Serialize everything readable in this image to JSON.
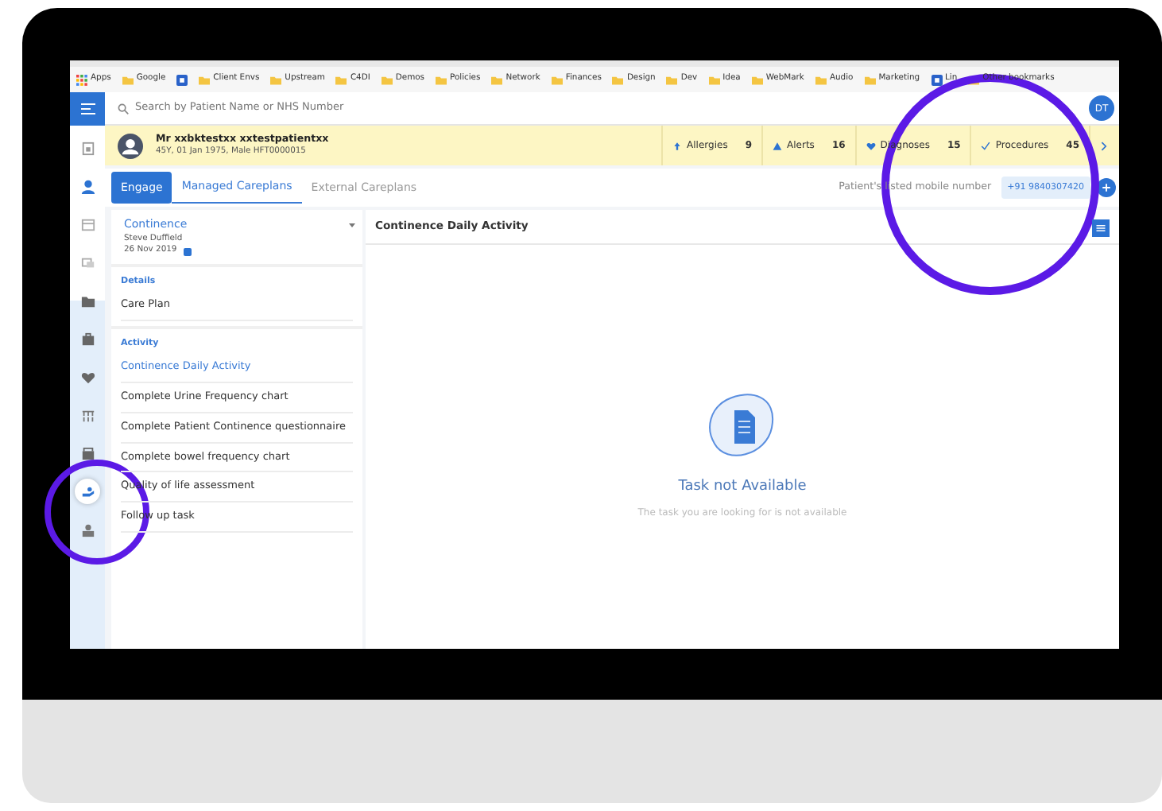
{
  "bookmarks": [
    {
      "label": "Apps",
      "kind": "apps"
    },
    {
      "label": "Google",
      "kind": "folder"
    },
    {
      "kind": "site"
    },
    {
      "label": "Client Envs",
      "kind": "folder"
    },
    {
      "label": "Upstream",
      "kind": "folder"
    },
    {
      "label": "C4DI",
      "kind": "folder"
    },
    {
      "label": "Demos",
      "kind": "folder"
    },
    {
      "label": "Policies",
      "kind": "folder"
    },
    {
      "label": "Network",
      "kind": "folder"
    },
    {
      "label": "Finances",
      "kind": "folder"
    },
    {
      "label": "Design",
      "kind": "folder"
    },
    {
      "label": "Dev",
      "kind": "folder"
    },
    {
      "label": "Idea",
      "kind": "folder"
    },
    {
      "label": "WebMark",
      "kind": "folder"
    },
    {
      "label": "Audio",
      "kind": "folder"
    },
    {
      "label": "Marketing",
      "kind": "folder"
    },
    {
      "label": "Lin",
      "kind": "site"
    },
    {
      "label": "Other bookmarks",
      "kind": "folder"
    }
  ],
  "search": {
    "placeholder": "Search by Patient Name or NHS Number"
  },
  "user_initials": "DT",
  "sidebar": [
    {
      "selected": false
    },
    {
      "selected": false
    },
    {
      "selected": false
    },
    {
      "selected": false
    },
    {
      "selected": false
    },
    {
      "selected": false
    },
    {
      "selected": false
    },
    {
      "selected": false
    },
    {
      "selected": false
    },
    {
      "selected": true
    },
    {
      "selected": false
    }
  ],
  "patient": {
    "name": "Mr xxbktestxx xxtestpatientxx",
    "details": "45Y, 01 Jan 1975, Male HFT0000015",
    "counts": [
      {
        "label": "Allergies",
        "value": "9"
      },
      {
        "label": "Alerts",
        "value": "16"
      },
      {
        "label": "Diagnoses",
        "value": "15"
      },
      {
        "label": "Procedures",
        "value": "45"
      }
    ]
  },
  "tabs": [
    {
      "label": "Engage",
      "kind": "button"
    },
    {
      "label": "Managed Careplans",
      "kind": "tab",
      "selected": true
    },
    {
      "label": "External Careplans",
      "kind": "tab",
      "selected": false
    }
  ],
  "mobile": {
    "label": "Patient's listed mobile number",
    "number": "+91 9840307420"
  },
  "careplan": {
    "title": "Continence",
    "owner": "Steve Duffield",
    "date": "26 Nov 2019"
  },
  "sections": [
    {
      "heading": "Details",
      "items": [
        {
          "label": "Care Plan",
          "selected": false
        }
      ]
    },
    {
      "heading": "Activity",
      "items": [
        {
          "label": "Continence Daily Activity",
          "selected": true
        },
        {
          "label": "Complete Urine Frequency chart",
          "selected": false
        },
        {
          "label": "Complete Patient Continence questionnaire",
          "selected": false
        },
        {
          "label": "Complete bowel frequency chart",
          "selected": false
        },
        {
          "label": "Quality of life assessment",
          "selected": false
        },
        {
          "label": "Follow up task",
          "selected": false
        }
      ]
    }
  ],
  "panel_title": "Continence Daily Activity",
  "empty": {
    "title": "Task not Available",
    "message": "The task you are looking for is not available"
  }
}
